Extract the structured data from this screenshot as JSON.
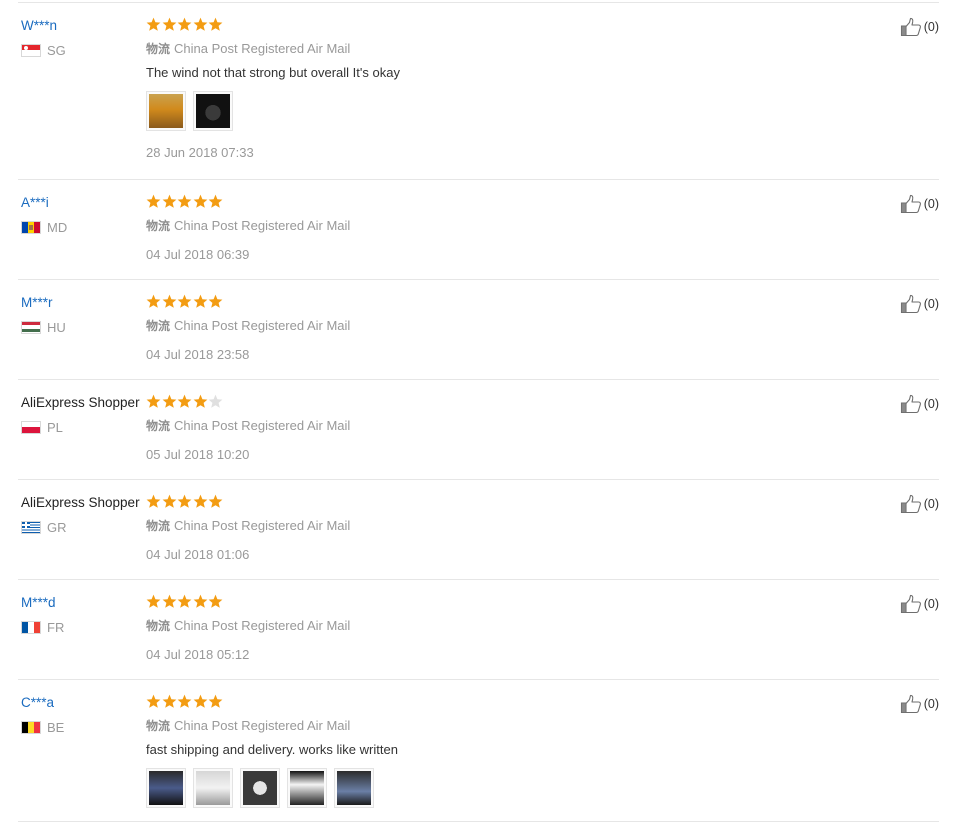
{
  "colors": {
    "star_on": "#f39c12",
    "star_off": "#e0e0e0",
    "link": "#1a6bbf",
    "muted": "#999999",
    "divider": "#e6e6e6"
  },
  "reviews": [
    {
      "user": "W***n",
      "user_link": true,
      "country": "SG",
      "flag": "flag-sg-icon",
      "rating": 5,
      "shipping_icon": "物流",
      "shipping": "China Post Registered Air Mail",
      "comment": "The wind not that strong but overall It's okay",
      "photos": [
        "photo-thumbnail-fan-orange",
        "photo-thumbnail-fan-dark"
      ],
      "date": "28 Jun 2018 07:33",
      "helpful": "(0)"
    },
    {
      "user": "A***i",
      "user_link": true,
      "country": "MD",
      "flag": "flag-md-icon",
      "rating": 5,
      "shipping_icon": "物流",
      "shipping": "China Post Registered Air Mail",
      "comment": "",
      "photos": [],
      "date": "04 Jul 2018 06:39",
      "helpful": "(0)"
    },
    {
      "user": "M***r",
      "user_link": true,
      "country": "HU",
      "flag": "flag-hu-icon",
      "rating": 5,
      "shipping_icon": "物流",
      "shipping": "China Post Registered Air Mail",
      "comment": "",
      "photos": [],
      "date": "04 Jul 2018 23:58",
      "helpful": "(0)"
    },
    {
      "user": "AliExpress Shopper",
      "user_link": false,
      "country": "PL",
      "flag": "flag-pl-icon",
      "rating": 4,
      "shipping_icon": "物流",
      "shipping": "China Post Registered Air Mail",
      "comment": "",
      "photos": [],
      "date": "05 Jul 2018 10:20",
      "helpful": "(0)"
    },
    {
      "user": "AliExpress Shopper",
      "user_link": false,
      "country": "GR",
      "flag": "flag-gr-icon",
      "rating": 5,
      "shipping_icon": "物流",
      "shipping": "China Post Registered Air Mail",
      "comment": "",
      "photos": [],
      "date": "04 Jul 2018 01:06",
      "helpful": "(0)"
    },
    {
      "user": "M***d",
      "user_link": true,
      "country": "FR",
      "flag": "flag-fr-icon",
      "rating": 5,
      "shipping_icon": "物流",
      "shipping": "China Post Registered Air Mail",
      "comment": "",
      "photos": [],
      "date": "04 Jul 2018 05:12",
      "helpful": "(0)"
    },
    {
      "user": "C***a",
      "user_link": true,
      "country": "BE",
      "flag": "flag-be-icon",
      "rating": 5,
      "shipping_icon": "物流",
      "shipping": "China Post Registered Air Mail",
      "comment": "fast shipping and delivery. works like written",
      "photos": [
        "photo-thumbnail-1",
        "photo-thumbnail-2",
        "photo-thumbnail-3",
        "photo-thumbnail-4",
        "photo-thumbnail-5"
      ],
      "date": "",
      "helpful": "(0)"
    }
  ]
}
